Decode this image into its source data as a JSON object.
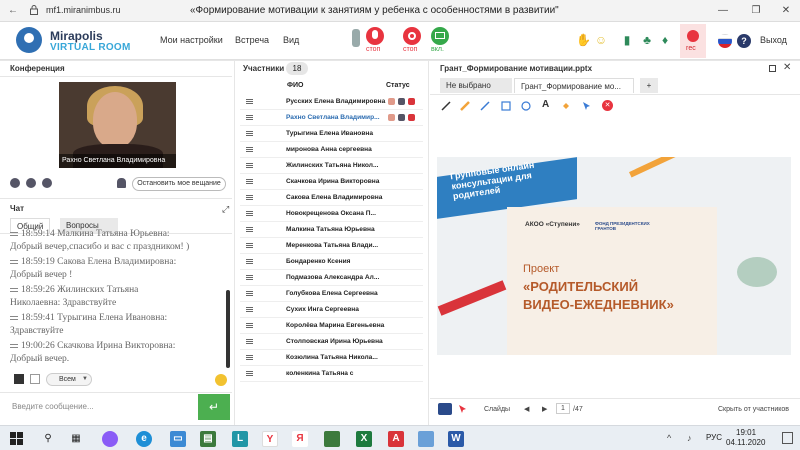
{
  "browser": {
    "url": "mf1.miranimbus.ru",
    "title": "«Формирование мотивации к занятиям у ребенка с особенностями в развитии\"",
    "buttons": [
      "—",
      "❐",
      "✕"
    ]
  },
  "header": {
    "logo_line1": "Mirapolis",
    "logo_line2": "VIRTUAL ROOM",
    "menu": [
      "Мои настройки",
      "Встреча",
      "Вид"
    ],
    "controls": [
      {
        "label": "стоп",
        "color": "#e8343f"
      },
      {
        "label": "стоп",
        "color": "#e8343f"
      },
      {
        "label": "вкл.",
        "color": "#35a84a"
      }
    ],
    "rec_label": "rec",
    "exit_label": "Выход"
  },
  "conference": {
    "title": "Конференция",
    "speaker_name": "Рахно Светлана  Владимировна",
    "stop_broadcast_label": "Остановить мое вещание"
  },
  "chat": {
    "title": "Чат",
    "tabs": [
      "Общий",
      "Вопросы"
    ],
    "messages": [
      {
        "line1": "18:59:14 Малкина Татьяна Юрьевна:",
        "line2": "Добрый вечер,спасибо и вас с праздником! )"
      },
      {
        "line1": "18:59:19 Сакова Елена Владимировна:",
        "line2": "Добрый вечер !"
      },
      {
        "line1": "18:59:26 Жилинских Татьяна",
        "line2": "Николаевна: Здравствуйте"
      },
      {
        "line1": "18:59:41 Турыгина Елена Ивановна:",
        "line2": "Здравствуйте"
      },
      {
        "line1": "19:00:26 Скачкова Ирина Викторовна:",
        "line2": "Добрый вечер."
      }
    ],
    "recipient": "Всем",
    "input_placeholder": "Введите сообщение..."
  },
  "participants": {
    "title": "Участники",
    "count": "18",
    "col_name": "ФИО",
    "col_status": "Статус",
    "rows": [
      {
        "name": "Русских Елена Владимировна",
        "highlight": false
      },
      {
        "name": "Рахно Светлана Владимир...",
        "highlight": true
      },
      {
        "name": "Турыгина Елена Ивановна",
        "highlight": false
      },
      {
        "name": "миронова Анна сергеевна",
        "highlight": false
      },
      {
        "name": "Жилинских Татьяна Никол...",
        "highlight": false
      },
      {
        "name": "Скачкова Ирина Викторовна",
        "highlight": false
      },
      {
        "name": "Сакова Елена Владимировна",
        "highlight": false
      },
      {
        "name": "Новокрещенова Оксана П...",
        "highlight": false
      },
      {
        "name": "Малкина Татьяна Юрьевна",
        "highlight": false
      },
      {
        "name": "Меренкова Татьяна Влади...",
        "highlight": false
      },
      {
        "name": "Бондаренко Ксения",
        "highlight": false
      },
      {
        "name": "Подмазова Александра Ал...",
        "highlight": false
      },
      {
        "name": "Голубкова Елена Сергеевна",
        "highlight": false
      },
      {
        "name": "Сухих Инга Сергеевна",
        "highlight": false
      },
      {
        "name": "Королёва Марина Евгеньевна",
        "highlight": false
      },
      {
        "name": "Столповская Ирина Юрьевна",
        "highlight": false
      },
      {
        "name": "Козюлина Татьяна Никола...",
        "highlight": false
      },
      {
        "name": "коленкина Татьяна с",
        "highlight": false
      }
    ]
  },
  "presentation": {
    "title": "Грант_Формирование мотивации.pptx",
    "tabs": [
      "Не выбрано",
      "Грант_Формирование мо..."
    ],
    "add_tab": "+",
    "slide": {
      "banner": "Групповые онлайн консультации для родителей",
      "org": "АКОО «Ступени»",
      "fund": "ФОНД ПРЕЗИДЕНТСКИХ ГРАНТОВ",
      "project_label": "Проект",
      "project_title_1": "«РОДИТЕЛЬСКИЙ",
      "project_title_2": "ВИДЕО-ЕЖЕДНЕВНИК»"
    },
    "slides_label": "Слайды",
    "page_current": "1",
    "page_total": "/47",
    "hide_label": "Скрыть от участников"
  },
  "taskbar": {
    "time": "19:01",
    "date": "04.11.2020",
    "lang": "РУС"
  }
}
